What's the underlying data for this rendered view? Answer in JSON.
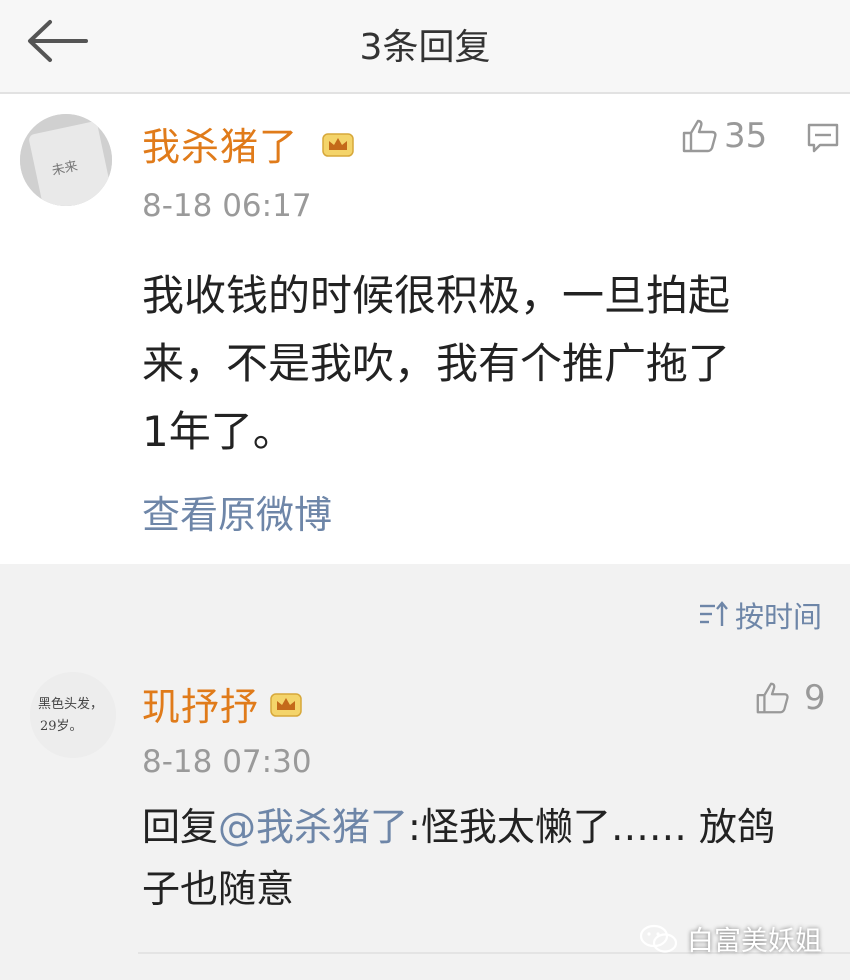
{
  "header": {
    "title": "3条回复"
  },
  "main_comment": {
    "username": "我杀猪了",
    "timestamp": "8-18 06:17",
    "like_count": "35",
    "avatar_text": "未来",
    "body_lines": [
      "我收钱的时候很积极，一旦拍起",
      "来，不是我吹，我有个推广拖了",
      "1年了。"
    ],
    "view_original_label": "查看原微博"
  },
  "sort": {
    "label": "按时间"
  },
  "reply": {
    "username": "玑抒抒",
    "timestamp": "8-18 07:30",
    "like_count": "9",
    "avatar_lines": [
      "黑色头发，",
      "29岁。"
    ],
    "prefix": "回复",
    "mention": "@我杀猪了",
    "text_line1": ":怪我太懒了…… 放鸽",
    "text_line2": "子也随意"
  },
  "watermark": {
    "text": "白富美妖姐"
  },
  "colors": {
    "username": "#e07b1a",
    "link": "#6e86a8",
    "timestamp": "#9a9a9a"
  }
}
